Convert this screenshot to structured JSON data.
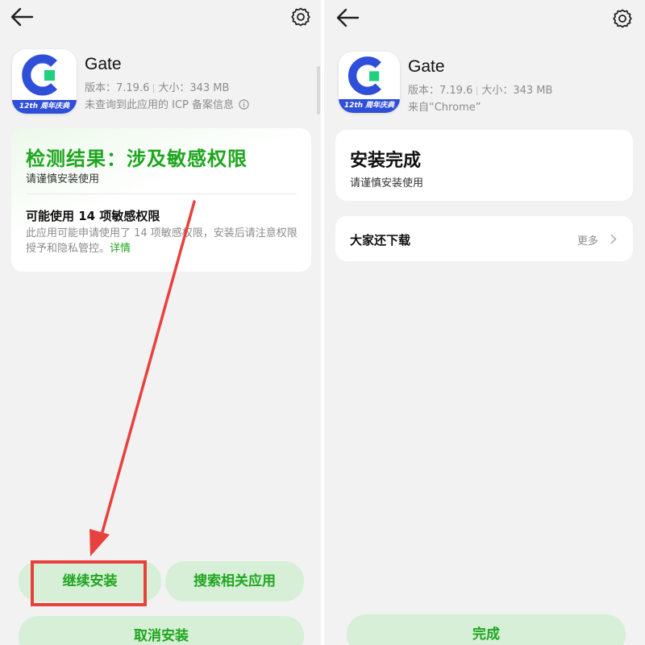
{
  "left": {
    "app": {
      "name": "Gate",
      "version": "版本：7.19.6",
      "size": "大小：343 MB",
      "icp_note": "未查询到此应用的 ICP 备案信息",
      "badge": "12th 周年庆典"
    },
    "result_card": {
      "title": "检测结果：涉及敏感权限",
      "subtitle": "请谨慎安装使用",
      "perm_title": "可能使用 14 项敏感权限",
      "perm_desc": "此应用可能申请使用了 14 项敏感权限，安装后请注意权限授予和隐私管控。",
      "details_link": "详情"
    },
    "buttons": {
      "continue": "继续安装",
      "search": "搜索相关应用",
      "cancel": "取消安装"
    }
  },
  "right": {
    "app": {
      "name": "Gate",
      "version": "版本：7.19.6",
      "size": "大小：343 MB",
      "source": "来自“Chrome”",
      "badge": "12th 周年庆典"
    },
    "complete_card": {
      "title": "安装完成",
      "subtitle": "请谨慎安装使用"
    },
    "downloads_row": {
      "label": "大家还下载",
      "more": "更多"
    },
    "buttons": {
      "done": "完成"
    }
  },
  "colors": {
    "accent_green": "#1fa61f",
    "button_bg": "#d6efd6",
    "highlight_red": "#e8413d",
    "brand_blue": "#2f4fd8",
    "brand_green": "#1fd17c"
  },
  "icons": [
    "back-arrow-icon",
    "gear-icon",
    "info-icon",
    "chevron-right-icon",
    "gate-logo-icon"
  ]
}
